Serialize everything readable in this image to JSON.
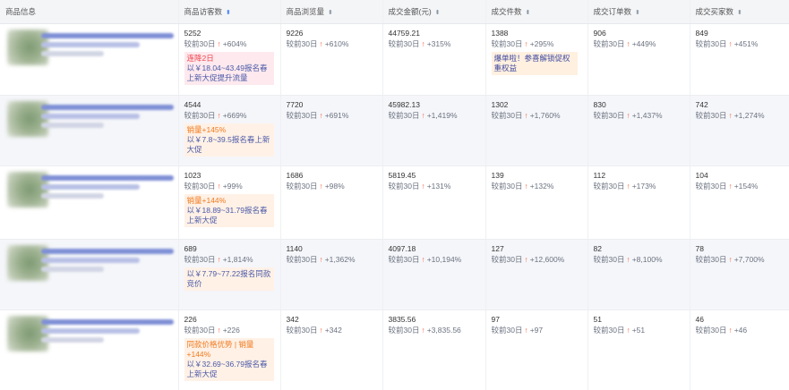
{
  "header": {
    "columns": [
      {
        "label": "商品信息",
        "sortable": false
      },
      {
        "label": "商品访客数",
        "sortable": true,
        "active": true
      },
      {
        "label": "商品浏览量",
        "sortable": true
      },
      {
        "label": "成交金额(元)",
        "sortable": true
      },
      {
        "label": "成交件数",
        "sortable": true
      },
      {
        "label": "成交订单数",
        "sortable": true
      },
      {
        "label": "成交买家数",
        "sortable": true
      }
    ]
  },
  "compare_prefix": "较前30日",
  "rows": [
    {
      "visitors": {
        "value": "5252",
        "pct": "+604%"
      },
      "tip_visitors": {
        "style": "pink",
        "line1": "连降2日",
        "line2": "以￥18.04~43.49报名春上新大促提升流量"
      },
      "views": {
        "value": "9226",
        "pct": "+610%"
      },
      "amount": {
        "value": "44759.21",
        "pct": "+315%"
      },
      "pieces": {
        "value": "1388",
        "pct": "+295%"
      },
      "badge_pieces": "爆单啦！参喜解锁促权重权益",
      "orders": {
        "value": "906",
        "pct": "+449%"
      },
      "buyers": {
        "value": "849",
        "pct": "+451%"
      }
    },
    {
      "visitors": {
        "value": "4544",
        "pct": "+669%"
      },
      "tip_visitors": {
        "style": "orange",
        "line1": "销量+145%",
        "line2": "以￥7.8~39.5报名春上新大促"
      },
      "views": {
        "value": "7720",
        "pct": "+691%"
      },
      "amount": {
        "value": "45982.13",
        "pct": "+1,419%"
      },
      "pieces": {
        "value": "1302",
        "pct": "+1,760%"
      },
      "orders": {
        "value": "830",
        "pct": "+1,437%"
      },
      "buyers": {
        "value": "742",
        "pct": "+1,274%"
      }
    },
    {
      "visitors": {
        "value": "1023",
        "pct": "+99%"
      },
      "tip_visitors": {
        "style": "orange",
        "line1": "销量+144%",
        "line2": "以￥18.89~31.79报名春上新大促"
      },
      "views": {
        "value": "1686",
        "pct": "+98%"
      },
      "amount": {
        "value": "5819.45",
        "pct": "+131%"
      },
      "pieces": {
        "value": "139",
        "pct": "+132%"
      },
      "orders": {
        "value": "112",
        "pct": "+173%"
      },
      "buyers": {
        "value": "104",
        "pct": "+154%"
      }
    },
    {
      "visitors": {
        "value": "689",
        "pct": "+1,814%"
      },
      "tip_visitors": {
        "style": "orange",
        "line1": "",
        "line2": "以￥7.79~77.22报名同款竞价"
      },
      "views": {
        "value": "1140",
        "pct": "+1,362%"
      },
      "amount": {
        "value": "4097.18",
        "pct": "+10,194%"
      },
      "pieces": {
        "value": "127",
        "pct": "+12,600%"
      },
      "orders": {
        "value": "82",
        "pct": "+8,100%"
      },
      "buyers": {
        "value": "78",
        "pct": "+7,700%"
      }
    },
    {
      "visitors": {
        "value": "226",
        "pct": "+226"
      },
      "tip_visitors": {
        "style": "orange",
        "line1": "同款价格优势 | 销量+144%",
        "line2": "以￥32.69~36.79报名春上新大促"
      },
      "views": {
        "value": "342",
        "pct": "+342"
      },
      "amount": {
        "value": "3835.56",
        "pct": "+3,835.56"
      },
      "pieces": {
        "value": "97",
        "pct": "+97"
      },
      "orders": {
        "value": "51",
        "pct": "+51"
      },
      "buyers": {
        "value": "46",
        "pct": "+46"
      }
    }
  ],
  "icons": {
    "up_arrow": "↑",
    "sort": "⬍"
  },
  "colors": {
    "up": "#f0643c",
    "tip_pink": "#fde9ee",
    "tip_orange": "#fff1e6",
    "header_bg": "#f4f5f7"
  }
}
